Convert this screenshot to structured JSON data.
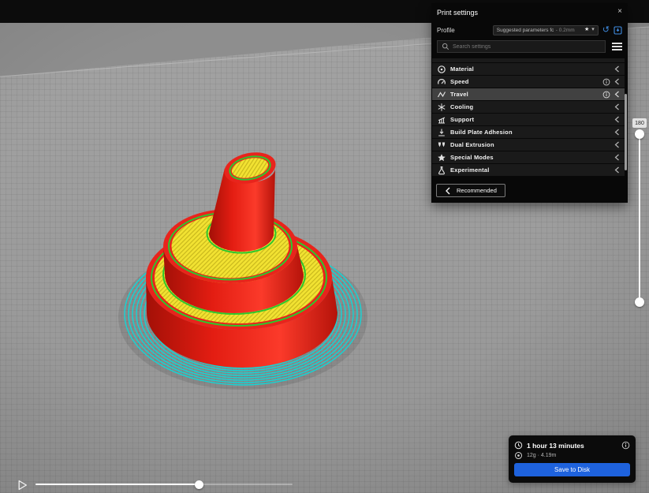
{
  "panel": {
    "title": "Print settings",
    "profile": {
      "label": "Profile",
      "value": "Suggested parameters for P...",
      "suffix": "- 0.2mm"
    },
    "search": {
      "placeholder": "Search settings"
    },
    "categories": [
      {
        "label": "Material"
      },
      {
        "label": "Speed"
      },
      {
        "label": "Travel"
      },
      {
        "label": "Cooling"
      },
      {
        "label": "Support"
      },
      {
        "label": "Build Plate Adhesion"
      },
      {
        "label": "Dual Extrusion"
      },
      {
        "label": "Special Modes"
      },
      {
        "label": "Experimental"
      }
    ],
    "recommended_label": "Recommended"
  },
  "icons": {
    "close": "×",
    "star": "★",
    "caret": "▾",
    "reset": "↺"
  },
  "layer_slider": {
    "current_layer": "180"
  },
  "job_info": {
    "print_time": "1 hour 13 minutes",
    "material_usage": "12g · 4.19m",
    "save_button": "Save to Disk"
  },
  "colors": {
    "accent_blue": "#1e62dd",
    "model_shell_red": "#e8241c",
    "model_infill_yellow": "#f2e232",
    "model_wall_green": "#2dc82d",
    "model_brim_cyan": "#12d6d6",
    "highlighted_row": "#414141"
  }
}
